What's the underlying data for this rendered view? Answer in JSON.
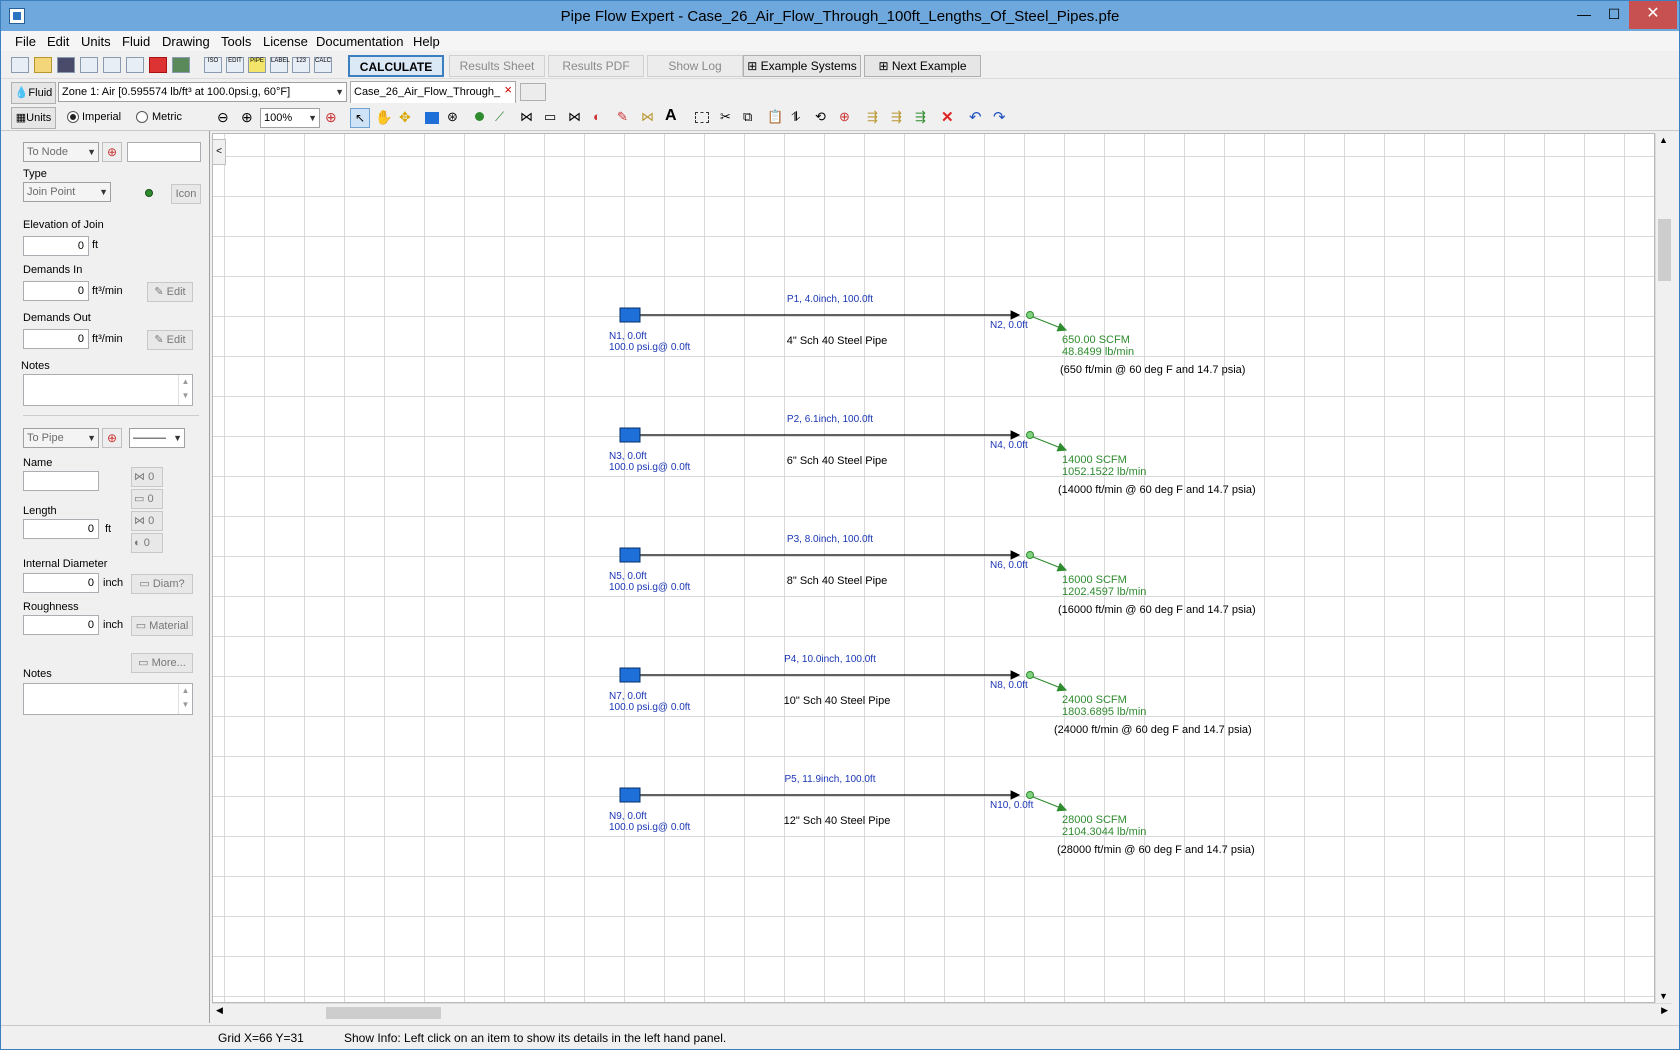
{
  "window": {
    "title": "Pipe Flow Expert - Case_26_Air_Flow_Through_100ft_Lengths_Of_Steel_Pipes.pfe",
    "minimize": "—",
    "maximize": "☐",
    "close": "✕"
  },
  "menu": [
    "File",
    "Edit",
    "Units",
    "Fluid",
    "Drawing",
    "Tools",
    "License",
    "Documentation",
    "Help"
  ],
  "toolbar": {
    "icon_labels": [
      "ISO",
      "EDIT",
      "PIPE",
      "LABEL",
      "123",
      "CALC"
    ],
    "calculate": "CALCULATE",
    "results_sheet": "Results Sheet",
    "results_pdf": "Results PDF",
    "show_log": "Show Log",
    "example_systems": "Example Systems",
    "next_example": "Next Example"
  },
  "fluid_bar": {
    "fluid_label": "Fluid",
    "zone": "Zone 1: Air [0.595574 lb/ft³ at 100.0psi.g, 60°F]",
    "tab": "Case_26_Air_Flow_Through_",
    "tab_close": "×"
  },
  "units_bar": {
    "units_label": "Units",
    "imperial": "Imperial",
    "metric": "Metric",
    "zoom": "100%"
  },
  "left_panel": {
    "node_select": "To Node",
    "type_label": "Type",
    "type_value": "Join Point",
    "icon_btn": "Icon",
    "elevation_label": "Elevation of Join",
    "elevation_value": "0",
    "elevation_unit": "ft",
    "demands_in_label": "Demands In",
    "demands_in_value": "0",
    "demands_in_unit": "ft³/min",
    "demands_out_label": "Demands Out",
    "demands_out_value": "0",
    "demands_out_unit": "ft³/min",
    "edit_btn": "Edit",
    "notes_label": "Notes",
    "pipe_select": "To Pipe",
    "line_style": "———",
    "name_label": "Name",
    "length_label": "Length",
    "length_value": "0",
    "length_unit": "ft",
    "fitting_counts": [
      "0",
      "0",
      "0",
      "0"
    ],
    "diameter_label": "Internal Diameter",
    "diameter_value": "0",
    "diameter_unit": "inch",
    "diam_btn": "Diam?",
    "roughness_label": "Roughness",
    "roughness_value": "0",
    "roughness_unit": "inch",
    "material_btn": "Material",
    "more_btn": "More...",
    "notes2_label": "Notes"
  },
  "network": [
    {
      "pipe_label": "P1, 4.0inch, 100.0ft",
      "pipe_desc": "4\" Sch 40 Steel Pipe",
      "start_node": "N1, 0.0ft",
      "start_pressure": "100.0 psi.g@ 0.0ft",
      "end_node": "N2, 0.0ft",
      "flow_scfm": "650.00 SCFM",
      "mass_flow": "48.8499 lb/min",
      "note": "(650 ft/min @ 60 deg F and 14.7 psia)"
    },
    {
      "pipe_label": "P2, 6.1inch, 100.0ft",
      "pipe_desc": "6\" Sch 40 Steel Pipe",
      "start_node": "N3, 0.0ft",
      "start_pressure": "100.0 psi.g@ 0.0ft",
      "end_node": "N4, 0.0ft",
      "flow_scfm": "14000 SCFM",
      "mass_flow": "1052.1522 lb/min",
      "note": "(14000 ft/min @ 60 deg F and 14.7 psia)"
    },
    {
      "pipe_label": "P3, 8.0inch, 100.0ft",
      "pipe_desc": "8\" Sch 40 Steel Pipe",
      "start_node": "N5, 0.0ft",
      "start_pressure": "100.0 psi.g@ 0.0ft",
      "end_node": "N6, 0.0ft",
      "flow_scfm": "16000 SCFM",
      "mass_flow": "1202.4597 lb/min",
      "note": "(16000 ft/min @ 60 deg F and 14.7 psia)"
    },
    {
      "pipe_label": "P4, 10.0inch, 100.0ft",
      "pipe_desc": "10\" Sch 40 Steel Pipe",
      "start_node": "N7, 0.0ft",
      "start_pressure": "100.0 psi.g@ 0.0ft",
      "end_node": "N8, 0.0ft",
      "flow_scfm": "24000 SCFM",
      "mass_flow": "1803.6895 lb/min",
      "note": "(24000 ft/min @ 60 deg F and 14.7 psia)"
    },
    {
      "pipe_label": "P5, 11.9inch, 100.0ft",
      "pipe_desc": "12\" Sch 40 Steel Pipe",
      "start_node": "N9, 0.0ft",
      "start_pressure": "100.0 psi.g@ 0.0ft",
      "end_node": "N10, 0.0ft",
      "flow_scfm": "28000 SCFM",
      "mass_flow": "2104.3044 lb/min",
      "note": "(28000 ft/min @ 60 deg F and 14.7 psia)"
    }
  ],
  "status": {
    "grid": "Grid  X=66  Y=31",
    "info": "Show Info: Left click on an item to show its details in the left hand panel."
  },
  "colors": {
    "tank": "#1e6fd8",
    "node_text": "#1a35b5",
    "flow": "#2e8b2e",
    "accent": "#3c7fc1"
  }
}
